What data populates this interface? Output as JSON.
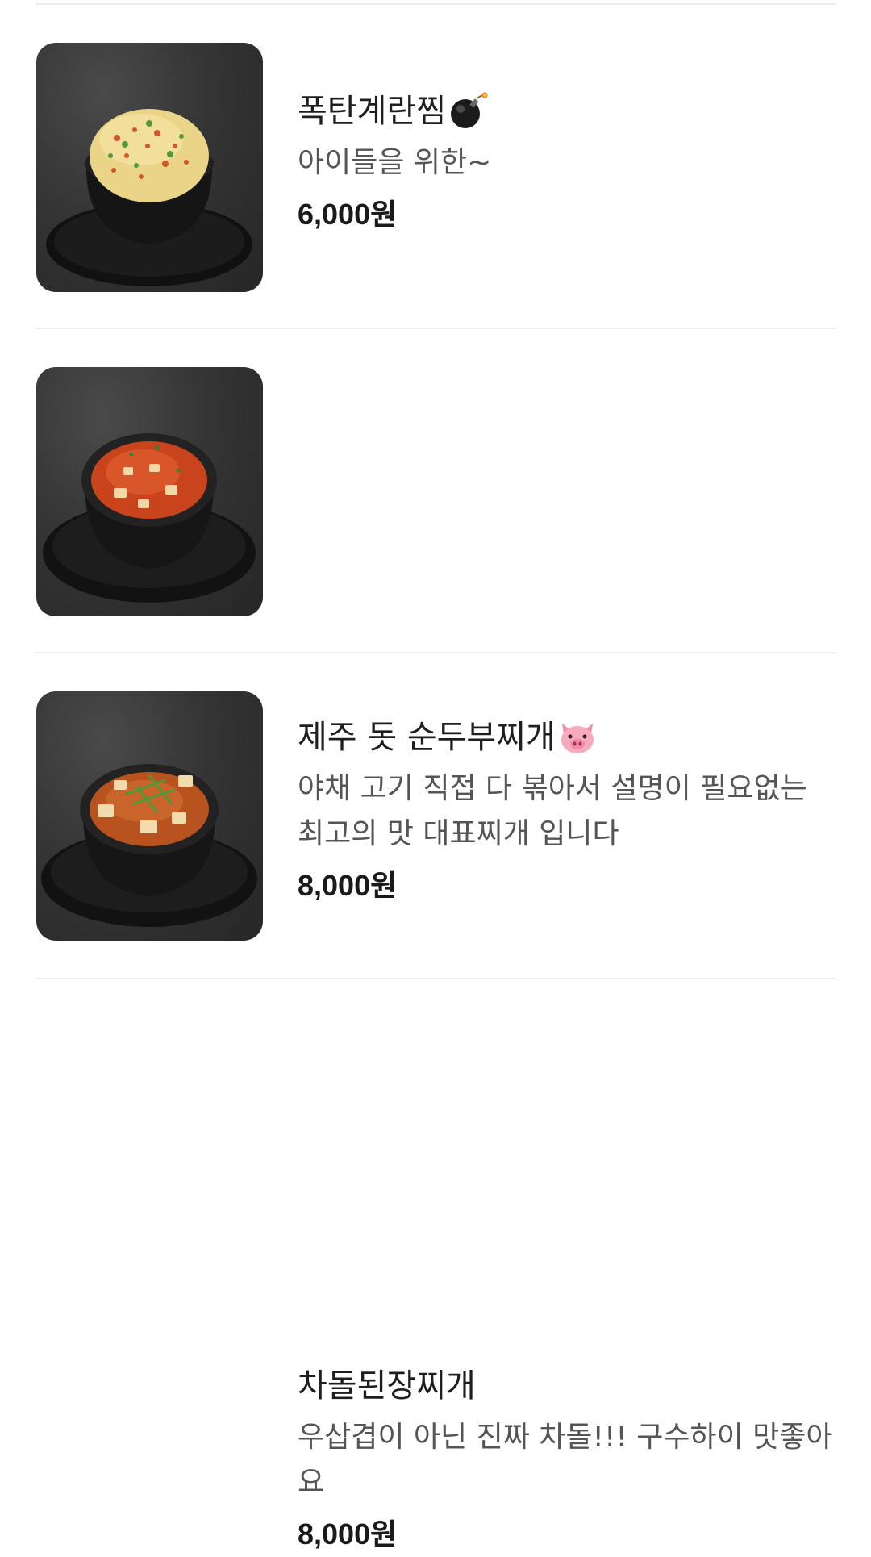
{
  "menu_items": [
    {
      "name": "폭탄계란찜",
      "emoji_icon": "bomb-icon",
      "description": "아이들을 위한~",
      "price": "6,000원"
    },
    {
      "name": "제주 돗 순두부찌개",
      "emoji_icon": "pig-face-icon",
      "description": "야채 고기 직접 다 볶아서 설명이 필요없는 최고의 맛 대표찌개 입니다",
      "price": "8,000원"
    },
    {
      "name": "차돌된장찌개",
      "emoji_icon": "",
      "description": "우삽겹이 아닌 진짜 차돌!!! 구수하이 맛좋아요",
      "price": "8,000원"
    }
  ],
  "colors": {
    "divider": "#eeeeee",
    "name_text": "#1e1e1e",
    "description_text": "#555555",
    "price_text": "#1a1a1a"
  }
}
